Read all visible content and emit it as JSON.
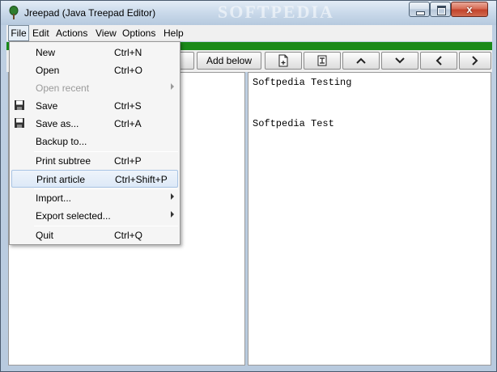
{
  "window": {
    "title": "Jreepad (Java Treepad Editor)",
    "watermark": "SOFTPEDIA",
    "close_glyph": "x",
    "icons": {
      "app": "tree-icon",
      "minimize": "minimize-icon",
      "maximize": "maximize-icon",
      "close": "close-icon"
    }
  },
  "menubar": [
    "File",
    "Edit",
    "Actions",
    "View",
    "Options",
    "Help"
  ],
  "toolbar": {
    "add_below_label": "Add below",
    "icons": [
      "new-child-icon",
      "edit-node-icon",
      "move-up-icon",
      "move-down-icon",
      "indent-left-icon",
      "indent-right-icon"
    ]
  },
  "file_menu": {
    "items": [
      {
        "label": "New",
        "shortcut": "Ctrl+N"
      },
      {
        "label": "Open",
        "shortcut": "Ctrl+O"
      },
      {
        "label": "Open recent",
        "shortcut": "",
        "disabled": true,
        "submenu": true
      },
      {
        "label": "Save",
        "shortcut": "Ctrl+S",
        "icon": "floppy-disk-icon"
      },
      {
        "label": "Save as...",
        "shortcut": "Ctrl+A",
        "icon": "floppy-disk-icon"
      },
      {
        "label": "Backup to...",
        "shortcut": ""
      },
      {
        "label": "Print subtree",
        "shortcut": "Ctrl+P"
      },
      {
        "label": "Print article",
        "shortcut": "Ctrl+Shift+P",
        "highlighted": true
      },
      {
        "label": "Import...",
        "shortcut": "",
        "submenu": true
      },
      {
        "label": "Export selected...",
        "shortcut": "",
        "submenu": true
      },
      {
        "label": "Quit",
        "shortcut": "Ctrl+Q"
      }
    ]
  },
  "article": {
    "lines": [
      "Softpedia Testing",
      "Softpedia Test"
    ]
  },
  "colors": {
    "green_strip": "#1a8a1a",
    "menu_highlight": "#dde9f7"
  }
}
